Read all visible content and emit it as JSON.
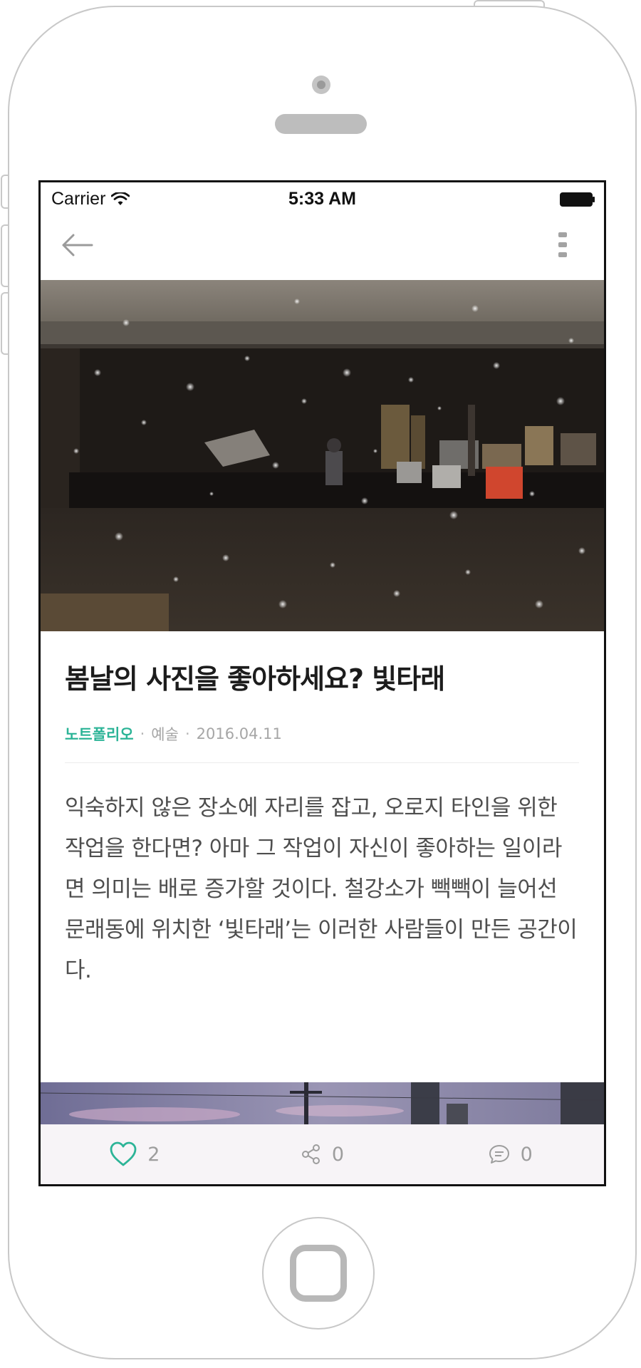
{
  "status_bar": {
    "carrier": "Carrier",
    "time": "5:33 AM",
    "wifi_icon": "wifi-icon",
    "battery_icon": "battery-full-icon"
  },
  "nav": {
    "back_icon": "arrow-left-icon",
    "more_icon": "more-vertical-icon"
  },
  "article": {
    "title": "봄날의 사진을 좋아하세요? 빛타래",
    "author": "노트폴리오",
    "separator": "·",
    "category": "예술",
    "date": "2016.04.11",
    "body": "익숙하지 않은 장소에 자리를 잡고, 오로지 타인을 위한 작업을 한다면? 아마 그 작업이 자신이 좋아하는 일이라면 의미는 배로 증가할 것이다. 철강소가 빽빽이 늘어선 문래동에 위치한 ‘빛타래’는 이러한 사람들이 만든 공간이다."
  },
  "actions": {
    "like_count": "2",
    "share_count": "0",
    "comment_count": "0"
  },
  "colors": {
    "accent": "#2cb497",
    "text": "#4e4e4e",
    "meta": "#a6a6a6"
  }
}
